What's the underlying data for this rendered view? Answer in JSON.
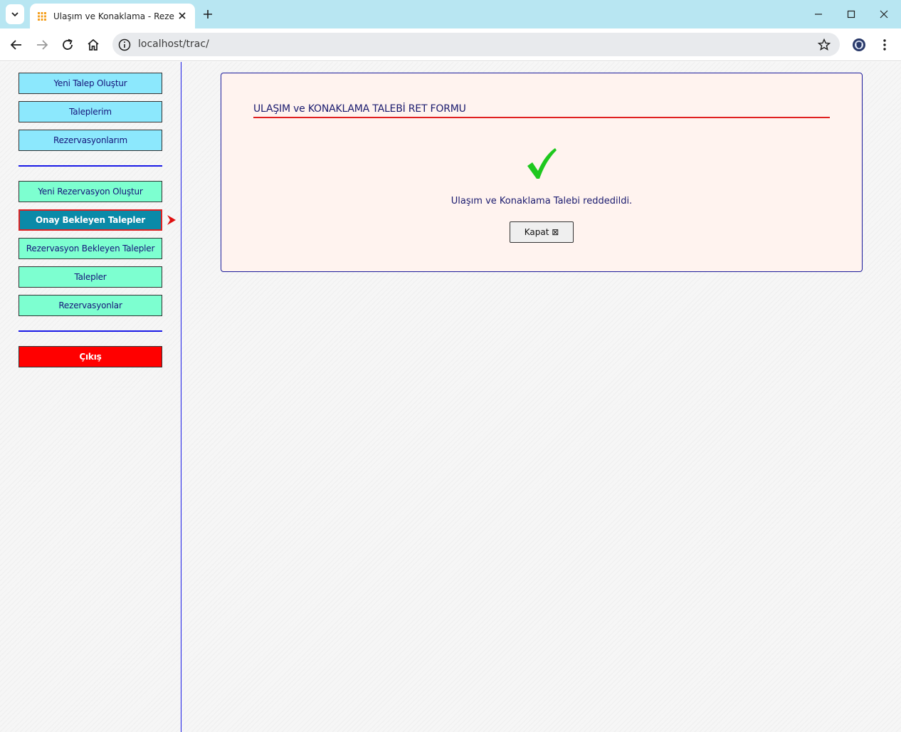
{
  "browser": {
    "tab_title": "Ulaşım ve Konaklama - Rezervasyon",
    "url": "localhost/trac/"
  },
  "sidebar": {
    "group1": [
      {
        "label": "Yeni Talep Oluştur"
      },
      {
        "label": "Taleplerim"
      },
      {
        "label": "Rezervasyonlarım"
      }
    ],
    "group2": [
      {
        "label": "Yeni Rezervasyon Oluştur"
      },
      {
        "label": "Onay Bekleyen Talepler"
      },
      {
        "label": "Rezervasyon Bekleyen Talepler"
      },
      {
        "label": "Talepler"
      },
      {
        "label": "Rezervasyonlar"
      }
    ],
    "active_item": "Onay Bekleyen Talepler",
    "logout_label": "Çıkış"
  },
  "panel": {
    "title": "ULAŞIM ve KONAKLAMA TALEBİ RET FORMU",
    "message": "Ulaşım ve Konaklama Talebi reddedildi.",
    "close_label": "Kapat ⊠",
    "status_icon": "check-icon"
  },
  "colors": {
    "accent_blue": "#1a1ae6",
    "cyan_button": "#8ce8fd",
    "mint_button": "#7dffd0",
    "active_button": "#0a8aa8",
    "logout_button": "#ff0000",
    "panel_bg": "#fff3ef",
    "check_green": "#1ec81e"
  }
}
